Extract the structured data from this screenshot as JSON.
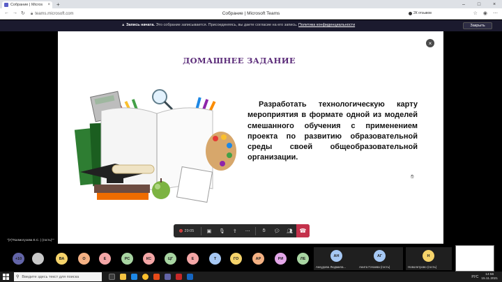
{
  "browser": {
    "tab_title": "Собрание | Micros",
    "url": "teams.microsoft.com",
    "page_title": "Собрание | Microsoft Teams",
    "reviews_label": "2К отзывов"
  },
  "banner": {
    "lead": "Запись начата.",
    "text": " Это собрание записывается. Присоединяясь, вы даете согласие на его запись. ",
    "link": "Политика конфиденциальности",
    "close_label": "Закрыть"
  },
  "slide": {
    "title": "ДОМАШНЕЕ ЗАДАНИЕ",
    "body": "Разработать технологическую карту мероприятия в формате одной из моделей смешанного обучения с применением проекта по развитию образовательной среды своей общеобразовательной организации."
  },
  "presenter_caption": "\"(У)\"Калмогузова Е.С. | (гость)\"\"",
  "controls": {
    "timer": "29:05"
  },
  "participants": [
    {
      "initials": "+10",
      "color": "#6264a7"
    },
    {
      "initials": "",
      "color": "#c8c8c8",
      "icon": "person-icon"
    },
    {
      "initials": "ВА",
      "color": "#f5d36a"
    },
    {
      "initials": "О",
      "color": "#f4b183"
    },
    {
      "initials": "Е",
      "color": "#f4a6a6"
    },
    {
      "initials": "РС",
      "color": "#a8d5a2"
    },
    {
      "initials": "КС",
      "color": "#f4a6a6"
    },
    {
      "initials": "ЦГ",
      "color": "#a8d5a2"
    },
    {
      "initials": "Е",
      "color": "#f4a6a6"
    },
    {
      "initials": "Т",
      "color": "#a6c8f4"
    },
    {
      "initials": "ГО",
      "color": "#f5d36a"
    },
    {
      "initials": "АР",
      "color": "#f4b183"
    },
    {
      "initials": "РИ",
      "color": "#e3a6e8"
    },
    {
      "initials": "ЛЕ",
      "color": "#a8d5a2"
    }
  ],
  "video_tiles": [
    {
      "initials": "АН",
      "color": "#a6c8f4",
      "name": "Анкудова Людмила..."
    },
    {
      "initials": "АГ",
      "color": "#a6c8f4",
      "name": "Анита Гочаева (гость)"
    },
    {
      "initials": "Н",
      "color": "#f5d36a",
      "name": "Новолетрово (гость)"
    }
  ],
  "taskbar": {
    "search_placeholder": "Введите здесь текст для поиска",
    "lang": "РУС",
    "time": "14:56",
    "date": "15.11.2021"
  }
}
